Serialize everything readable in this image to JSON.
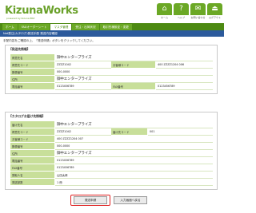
{
  "app": {
    "logo": "KizunaWorks",
    "logo_sub": "powered by Kizuna ERP"
  },
  "top_icons": [
    {
      "icon": "home-icon",
      "glyph": "⌂",
      "label": "ホーム"
    },
    {
      "icon": "help-icon",
      "glyph": "?",
      "label": "ヘルプ"
    },
    {
      "icon": "inquiry-icon",
      "glyph": "✉",
      "label": "お問い合わせ"
    },
    {
      "icon": "logout-icon",
      "glyph": "⏏",
      "label": "ログアウト"
    }
  ],
  "nav": {
    "tabs": [
      {
        "label": "ホーム"
      },
      {
        "label": "FAXオーダーシート"
      },
      {
        "label": "マスタ管理"
      },
      {
        "label": "受注・出荷状況"
      },
      {
        "label": "取引先様設定・変更"
      }
    ]
  },
  "header": {
    "title": "Net受注(カタログ)発送手配  発送内容確認",
    "instruction": "手配内容をご確認の上、「発送申請」ボタンをクリックしてください。"
  },
  "sender": {
    "title": "【発送先情報】",
    "rows": [
      {
        "label": "得意先名",
        "value": "御中エンタープライズ",
        "big": true
      },
      {
        "label": "得意先コード",
        "value": "ZZZZ1042",
        "label2": "お客様コード",
        "value2": "400 ZZZZ1204 006"
      },
      {
        "label": "郵便番号",
        "value": "000-0000"
      },
      {
        "label": "住所",
        "value": "御中エンタープライズ",
        "big": true
      },
      {
        "label": "電話番号",
        "value": "0123456789",
        "label2": "FAX番号",
        "value2": "0123456789"
      }
    ]
  },
  "recipient": {
    "title": "【カタログお届け先情報】",
    "rows": [
      {
        "label": "届け先名",
        "value": "御中エンタープライズ",
        "big": true
      },
      {
        "label": "得意先コード",
        "value": "ZZZZ1042",
        "label2": "届け先コード",
        "value2": "001"
      },
      {
        "label": "お客様コード",
        "value": "400 ZZZZ1204 007"
      },
      {
        "label": "郵便番号",
        "value": "000-0000"
      },
      {
        "label": "住所",
        "value": "御中エンタープライズ",
        "big": true
      },
      {
        "label": "電話番号",
        "value": "0123456789"
      },
      {
        "label": "FAX番号",
        "value": "0123456789"
      },
      {
        "label": "受取人名",
        "value": "山田太郎"
      },
      {
        "label": "発送部数",
        "value": "1  冊"
      }
    ]
  },
  "buttons": {
    "submit": "発送申請",
    "back": "入力画面へ戻る"
  }
}
